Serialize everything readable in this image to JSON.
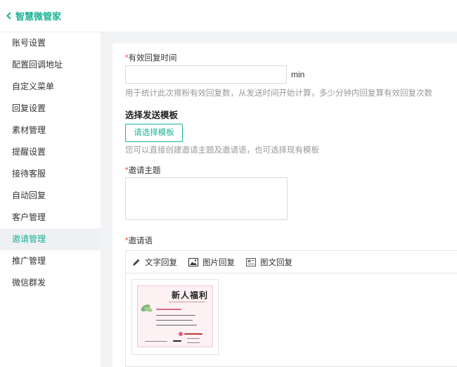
{
  "header": {
    "back_label": "智慧微管家"
  },
  "sidebar": {
    "items": [
      {
        "label": "账号设置"
      },
      {
        "label": "配置回调地址"
      },
      {
        "label": "自定义菜单"
      },
      {
        "label": "回复设置"
      },
      {
        "label": "素材管理"
      },
      {
        "label": "提醒设置"
      },
      {
        "label": "接待客服"
      },
      {
        "label": "自动回复"
      },
      {
        "label": "客户管理"
      },
      {
        "label": "邀请管理",
        "active": true
      },
      {
        "label": "推广管理"
      },
      {
        "label": "微信群发"
      }
    ]
  },
  "form": {
    "required_mark": "*",
    "valid_time": {
      "label": "有效回复时间",
      "value": "",
      "unit": "min",
      "hint": "用于统计此次擦粉有效回复数，从发送时间开始计算，多少分钟内回复算有效回复次数"
    },
    "template": {
      "title": "选择发送模板",
      "button_label": "请选择模板",
      "hint": "您可以直接创建邀请主题及邀请语，也可选择现有模板"
    },
    "subject": {
      "label": "邀请主题",
      "value": ""
    },
    "message": {
      "label": "邀请语",
      "tools": [
        {
          "label": "文字回复",
          "icon": "pencil-icon"
        },
        {
          "label": "图片回复",
          "icon": "image-icon"
        },
        {
          "label": "图文回复",
          "icon": "article-icon"
        }
      ],
      "card_title": "新人福利"
    }
  },
  "colors": {
    "accent": "#19b394",
    "required": "#f04134",
    "hint": "#999999",
    "background": "#f2f3f5"
  }
}
